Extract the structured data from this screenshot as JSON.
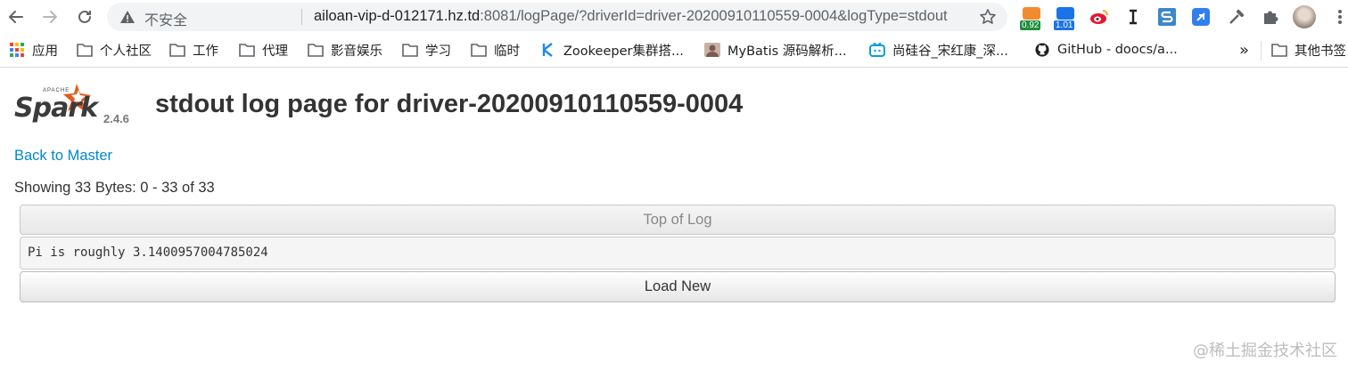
{
  "browser": {
    "insecure_label": "不安全",
    "url_host": "ailoan-vip-d-012171.hz.td",
    "url_rest": ":8081/logPage/?driverId=driver-20200910110559-0004&logType=stdout",
    "extensions": {
      "badge1": "0.92",
      "badge2": "1.01",
      "badge1_color": "#1e8e3e",
      "badge2_color": "#1a73e8"
    }
  },
  "bookmarks": {
    "apps": "应用",
    "items": [
      {
        "label": "个人社区",
        "icon": "folder-icon"
      },
      {
        "label": "工作",
        "icon": "folder-icon"
      },
      {
        "label": "代理",
        "icon": "folder-icon"
      },
      {
        "label": "影音娱乐",
        "icon": "folder-icon"
      },
      {
        "label": "学习",
        "icon": "folder-icon"
      },
      {
        "label": "临时",
        "icon": "folder-icon"
      },
      {
        "label": "Zookeeper集群搭...",
        "icon": "bookmark-icon"
      },
      {
        "label": "MyBatis 源码解析...",
        "icon": "avatar-icon"
      },
      {
        "label": "尚硅谷_宋红康_深...",
        "icon": "tv-icon"
      },
      {
        "label": "GitHub - doocs/a...",
        "icon": "github-icon"
      }
    ],
    "overflow": "»",
    "other": "其他书签"
  },
  "page": {
    "logo_word": "Spark",
    "logo_small": "APACHE",
    "version": "2.4.6",
    "title": "stdout log page for driver-20200910110559-0004",
    "back_link": "Back to Master",
    "showing": "Showing 33 Bytes: 0 - 33 of 33",
    "top_of_log": "Top of Log",
    "log_text": "Pi is roughly 3.1400957004785024",
    "load_new": "Load New",
    "link_color": "#0088cc",
    "spark_orange": "#e25a1c"
  },
  "watermark": "@稀土掘金技术社区"
}
